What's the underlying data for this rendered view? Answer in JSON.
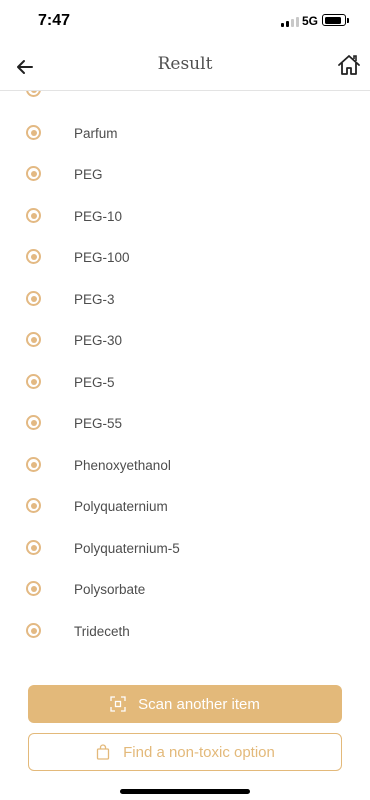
{
  "status": {
    "time": "7:47",
    "network": "5G"
  },
  "header": {
    "title": "Result"
  },
  "ingredients": [
    "Parfum",
    "PEG",
    "PEG-10",
    "PEG-100",
    "PEG-3",
    "PEG-30",
    "PEG-5",
    "PEG-55",
    "Phenoxyethanol",
    "Polyquaternium",
    "Polyquaternium-5",
    "Polysorbate",
    "Trideceth"
  ],
  "actions": {
    "scan_label": "Scan another item",
    "find_label": "Find a non-toxic option"
  },
  "colors": {
    "accent": "#e3b97a",
    "text": "#4d4d4d"
  },
  "icons": {
    "back": "arrow-left-icon",
    "home": "home-icon",
    "radio": "radio-selected-icon",
    "scan": "scan-icon",
    "bag": "shopping-bag-icon"
  }
}
